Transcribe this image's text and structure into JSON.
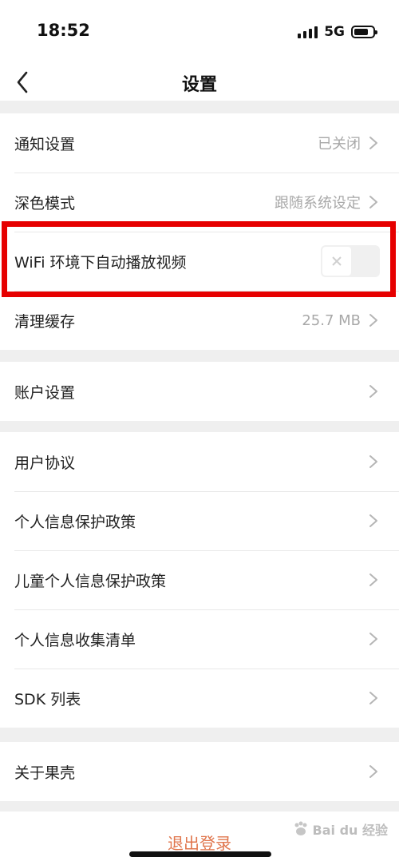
{
  "status_bar": {
    "time": "18:52",
    "network": "5G",
    "battery_icon": "battery-icon",
    "signal_icon": "signal-bars-icon"
  },
  "nav": {
    "title": "设置",
    "back_icon": "chevron-left-icon"
  },
  "groups": [
    {
      "items": [
        {
          "label": "通知设置",
          "value": "已关闭",
          "type": "link"
        },
        {
          "label": "深色模式",
          "value": "跟随系统设定",
          "type": "link"
        },
        {
          "label": "WiFi 环境下自动播放视频",
          "type": "toggle",
          "toggle_on": false
        },
        {
          "label": "清理缓存",
          "value": "25.7 MB",
          "type": "link"
        }
      ]
    },
    {
      "items": [
        {
          "label": "账户设置",
          "type": "link"
        }
      ]
    },
    {
      "items": [
        {
          "label": "用户协议",
          "type": "link"
        },
        {
          "label": "个人信息保护政策",
          "type": "link"
        },
        {
          "label": "儿童个人信息保护政策",
          "type": "link"
        },
        {
          "label": "个人信息收集清单",
          "type": "link"
        },
        {
          "label": "SDK 列表",
          "type": "link"
        }
      ]
    },
    {
      "items": [
        {
          "label": "关于果壳",
          "type": "link"
        }
      ]
    }
  ],
  "logout_label": "退出登录",
  "watermark_text": "Bai du 经验",
  "colors": {
    "highlight": "#e60000",
    "logout": "#e0764d",
    "value_text": "#a8a8a8",
    "background": "#efefef"
  }
}
